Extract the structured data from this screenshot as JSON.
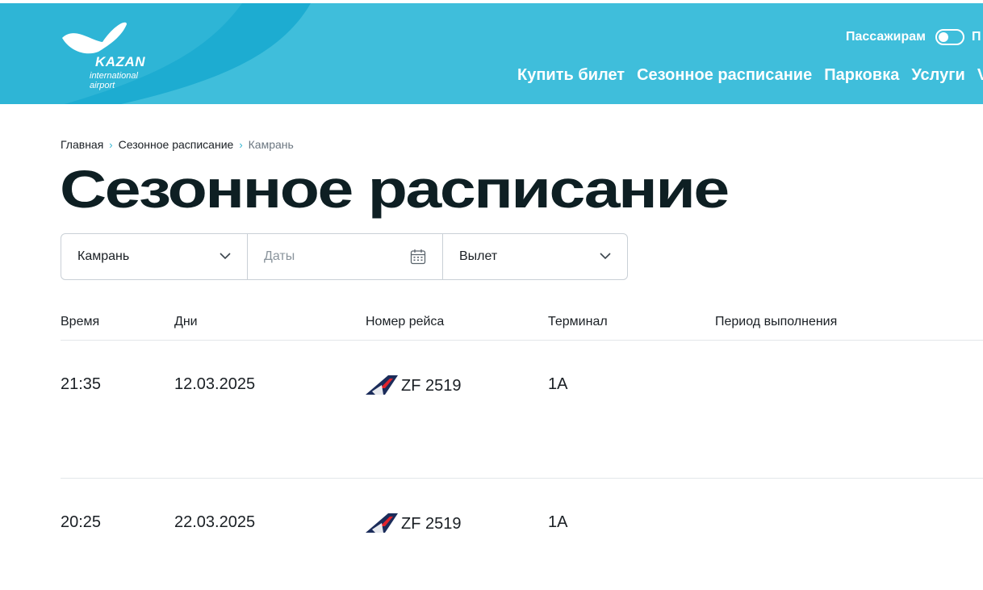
{
  "header": {
    "logo": {
      "name": "KAZAN",
      "sub1": "international",
      "sub2": "airport"
    },
    "passengers_label": "Пассажирам",
    "toggle_next_label": "П",
    "nav": [
      {
        "label": "Купить билет"
      },
      {
        "label": "Сезонное расписание"
      },
      {
        "label": "Парковка"
      },
      {
        "label": "Услуги"
      },
      {
        "label": "VI"
      }
    ],
    "colors": {
      "background": "#3fbedb",
      "accent": "#17a9cf"
    }
  },
  "breadcrumb": [
    {
      "label": "Главная"
    },
    {
      "label": "Сезонное расписание"
    },
    {
      "label": "Камрань"
    }
  ],
  "page_title": "Сезонное расписание",
  "filters": {
    "destination": {
      "value": "Камрань",
      "icon": "chevron-down-icon"
    },
    "dates": {
      "placeholder": "Даты",
      "icon": "calendar-icon"
    },
    "direction": {
      "value": "Вылет",
      "icon": "chevron-down-icon"
    }
  },
  "table": {
    "columns": [
      "Время",
      "Дни",
      "Номер рейса",
      "Терминал",
      "Период выполнения"
    ],
    "rows": [
      {
        "time": "21:35",
        "days": "12.03.2025",
        "flight": "ZF 2519",
        "airline_icon": "azur-air-tail-icon",
        "terminal": "1А",
        "period": ""
      },
      {
        "time": "20:25",
        "days": "22.03.2025",
        "flight": "ZF 2519",
        "airline_icon": "azur-air-tail-icon",
        "terminal": "1А",
        "period": ""
      }
    ]
  }
}
